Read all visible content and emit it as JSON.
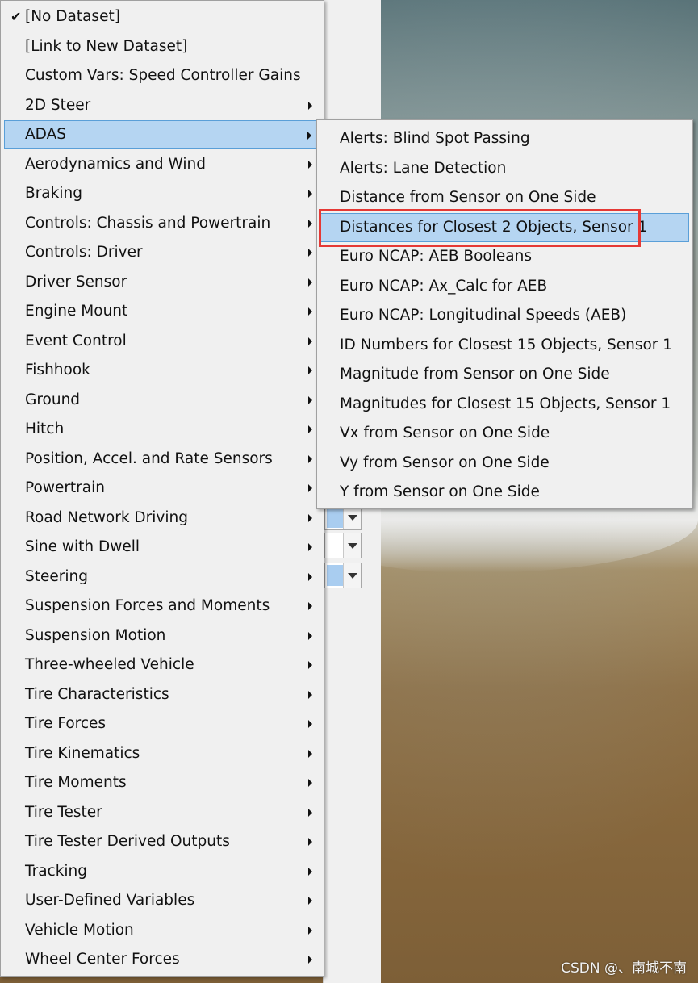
{
  "main_menu": {
    "items": [
      {
        "label": "[No Dataset]",
        "checked": true,
        "submenu": false
      },
      {
        "label": "[Link to New Dataset]",
        "submenu": false
      },
      {
        "label": "Custom Vars: Speed Controller Gains",
        "submenu": false
      },
      {
        "label": "2D Steer",
        "submenu": true
      },
      {
        "label": "ADAS",
        "submenu": true,
        "highlighted": true
      },
      {
        "label": "Aerodynamics and Wind",
        "submenu": true
      },
      {
        "label": "Braking",
        "submenu": true
      },
      {
        "label": "Controls: Chassis and Powertrain",
        "submenu": true
      },
      {
        "label": "Controls: Driver",
        "submenu": true
      },
      {
        "label": "Driver Sensor",
        "submenu": true
      },
      {
        "label": "Engine Mount",
        "submenu": true
      },
      {
        "label": "Event Control",
        "submenu": true
      },
      {
        "label": "Fishhook",
        "submenu": true
      },
      {
        "label": "Ground",
        "submenu": true
      },
      {
        "label": "Hitch",
        "submenu": true
      },
      {
        "label": "Position, Accel. and Rate Sensors",
        "submenu": true
      },
      {
        "label": "Powertrain",
        "submenu": true
      },
      {
        "label": "Road Network Driving",
        "submenu": true
      },
      {
        "label": "Sine with Dwell",
        "submenu": true
      },
      {
        "label": "Steering",
        "submenu": true
      },
      {
        "label": "Suspension Forces and Moments",
        "submenu": true
      },
      {
        "label": "Suspension Motion",
        "submenu": true
      },
      {
        "label": "Three-wheeled Vehicle",
        "submenu": true
      },
      {
        "label": "Tire Characteristics",
        "submenu": true
      },
      {
        "label": "Tire Forces",
        "submenu": true
      },
      {
        "label": "Tire Kinematics",
        "submenu": true
      },
      {
        "label": "Tire Moments",
        "submenu": true
      },
      {
        "label": "Tire Tester",
        "submenu": true
      },
      {
        "label": "Tire Tester Derived Outputs",
        "submenu": true
      },
      {
        "label": "Tracking",
        "submenu": true
      },
      {
        "label": "User-Defined Variables",
        "submenu": true
      },
      {
        "label": "Vehicle Motion",
        "submenu": true
      },
      {
        "label": "Wheel Center Forces",
        "submenu": true
      }
    ]
  },
  "sub_menu": {
    "items": [
      {
        "label": "Alerts: Blind Spot Passing"
      },
      {
        "label": "Alerts: Lane Detection"
      },
      {
        "label": "Distance from Sensor on One Side"
      },
      {
        "label": "Distances for Closest 2 Objects, Sensor 1",
        "highlighted": true
      },
      {
        "label": "Euro NCAP: AEB Booleans"
      },
      {
        "label": "Euro NCAP: Ax_Calc for AEB"
      },
      {
        "label": "Euro NCAP: Longitudinal Speeds (AEB)"
      },
      {
        "label": "ID Numbers for Closest 15 Objects, Sensor 1"
      },
      {
        "label": "Magnitude from Sensor on One Side"
      },
      {
        "label": "Magnitudes for Closest 15 Objects, Sensor 1"
      },
      {
        "label": "Vx from Sensor on One Side"
      },
      {
        "label": "Vy from Sensor on One Side"
      },
      {
        "label": "Y from Sensor on One Side"
      }
    ]
  },
  "check_glyph": "✔",
  "watermark": "CSDN @、南城不南",
  "colors": {
    "menu_bg": "#f0f0f0",
    "highlight_bg": "#b5d5f2",
    "highlight_border": "#5a9fd8",
    "annotation_red": "#e53935"
  }
}
